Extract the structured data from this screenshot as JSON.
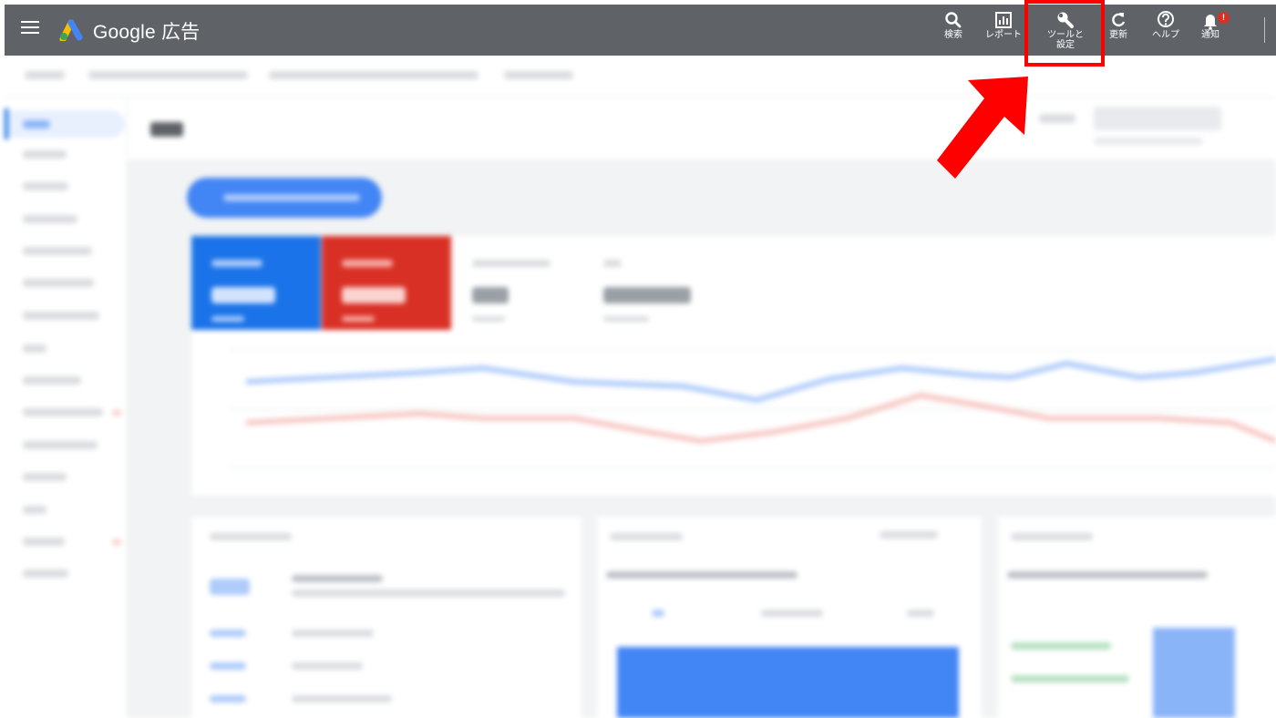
{
  "header": {
    "brand": "Google 広告",
    "buttons": [
      {
        "label": "検索",
        "icon": "search-icon"
      },
      {
        "label": "レポート",
        "icon": "reports-icon"
      },
      {
        "label_line1": "ツールと",
        "label_line2": "設定",
        "icon": "wrench-icon"
      },
      {
        "label": "更新",
        "icon": "refresh-icon"
      },
      {
        "label": "ヘルプ",
        "icon": "help-icon"
      },
      {
        "label": "通知",
        "icon": "bell-icon",
        "badge": "!"
      }
    ]
  },
  "annotation": {
    "highlight_color": "#ff0000",
    "target": "ツールと設定"
  },
  "colors": {
    "header_bg": "#5f6368",
    "accent_blue": "#4285f4",
    "accent_red": "#d93025"
  }
}
